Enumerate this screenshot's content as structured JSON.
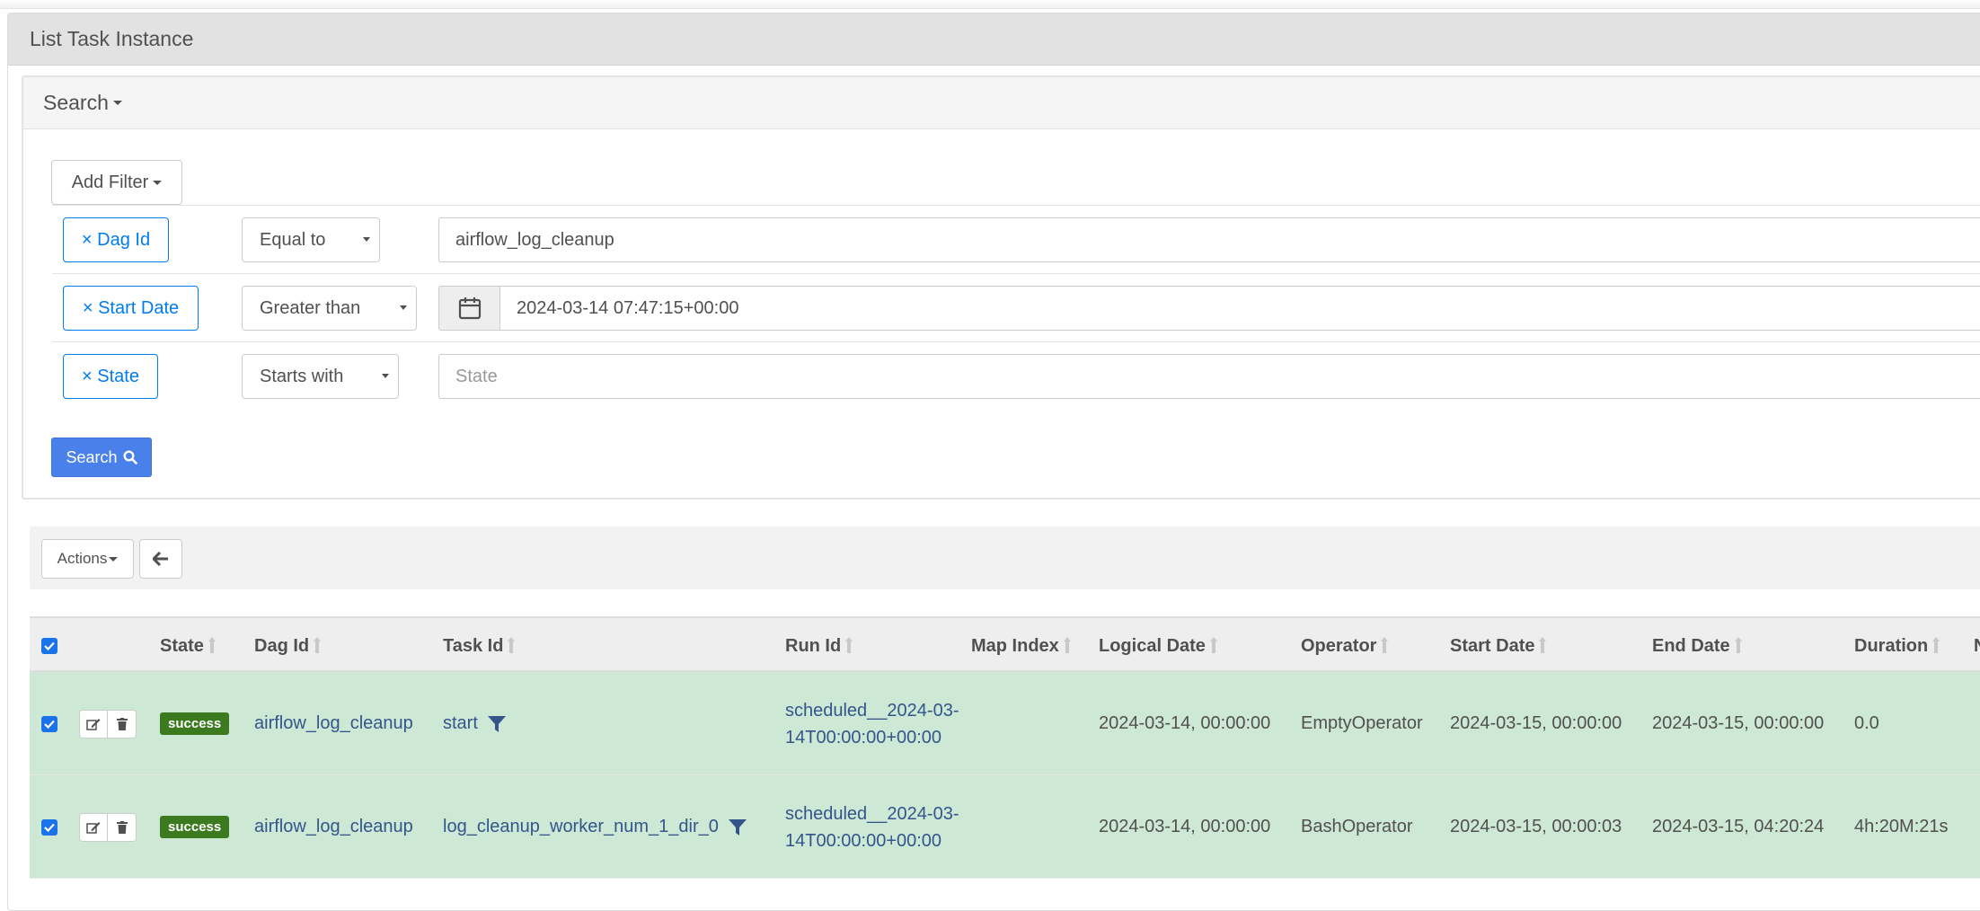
{
  "page": {
    "title": "List Task Instance"
  },
  "search": {
    "header_label": "Search",
    "add_filter_label": "Add Filter",
    "submit_label": "Search",
    "filters": [
      {
        "remove_label": "× Dag Id",
        "operator": "Equal to",
        "value": "airflow_log_cleanup",
        "placeholder": ""
      },
      {
        "remove_label": "× Start Date",
        "operator": "Greater than",
        "value": "2024-03-14 07:47:15+00:00",
        "placeholder": ""
      },
      {
        "remove_label": "× State",
        "operator": "Starts with",
        "value": "",
        "placeholder": "State"
      }
    ]
  },
  "toolbar": {
    "actions_label": "Actions"
  },
  "table": {
    "columns": {
      "state": "State",
      "dag_id": "Dag Id",
      "task_id": "Task Id",
      "run_id": "Run Id",
      "map_index": "Map Index",
      "logical_date": "Logical Date",
      "operator": "Operator",
      "start_date": "Start Date",
      "end_date": "End Date",
      "duration": "Duration",
      "next": "N"
    },
    "rows": [
      {
        "checked": true,
        "state": "success",
        "dag_id": "airflow_log_cleanup",
        "task_id": "start",
        "run_id": "scheduled__2024-03-14T00:00:00+00:00",
        "map_index": "",
        "logical_date": "2024-03-14, 00:00:00",
        "operator": "EmptyOperator",
        "start_date": "2024-03-15, 00:00:00",
        "end_date": "2024-03-15, 00:00:00",
        "duration": "0.0"
      },
      {
        "checked": true,
        "state": "success",
        "dag_id": "airflow_log_cleanup",
        "task_id": "log_cleanup_worker_num_1_dir_0",
        "run_id": "scheduled__2024-03-14T00:00:00+00:00",
        "map_index": "",
        "logical_date": "2024-03-14, 00:00:00",
        "operator": "BashOperator",
        "start_date": "2024-03-15, 00:00:03",
        "end_date": "2024-03-15, 04:20:24",
        "duration": "4h:20M:21s"
      }
    ]
  },
  "colors": {
    "primary": "#017cee",
    "search_button": "#4a80ea",
    "success_badge": "#3c7a1f",
    "success_row": "#cde8d4"
  },
  "icons": {
    "calendar": "calendar-icon",
    "search": "search-icon",
    "back": "arrow-left-icon",
    "edit": "edit-icon",
    "delete": "trash-icon",
    "filter": "filter-icon",
    "checkbox": "checkbox-checked-icon"
  }
}
